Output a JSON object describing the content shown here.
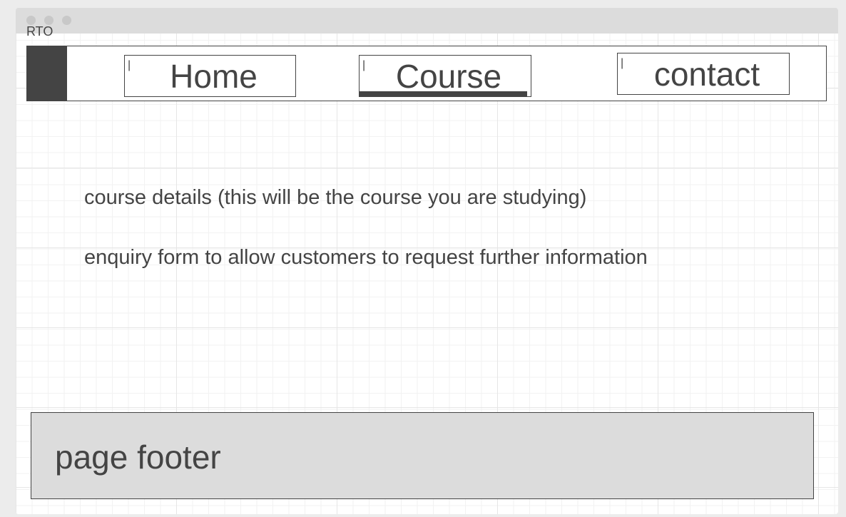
{
  "app": {
    "title": "RTO"
  },
  "nav": {
    "items": [
      {
        "label": "Home",
        "active": false
      },
      {
        "label": "Course",
        "active": true
      },
      {
        "label": "contact",
        "active": false
      }
    ]
  },
  "content": {
    "course_details": "course details (this will be the course you are studying)",
    "enquiry_form": "enquiry form to allow customers to request further information"
  },
  "footer": {
    "text": "page footer"
  },
  "colors": {
    "ink": "#444444",
    "titlebar": "#dcdcdc",
    "footer_bg": "#dcdcdc",
    "canvas": "#ffffff"
  }
}
